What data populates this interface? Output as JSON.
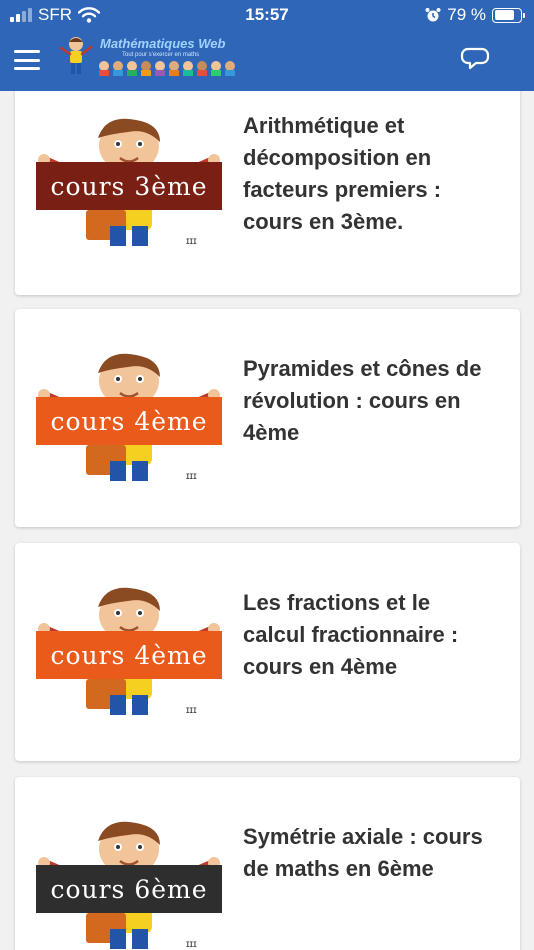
{
  "status_bar": {
    "carrier": "SFR",
    "time": "15:57",
    "battery": "79 %",
    "battery_level": 0.79
  },
  "header": {
    "logo_title": "Mathématiques Web",
    "logo_subtitle": "Tout pour s'exercer en maths",
    "menu_icon": "hamburger-menu-icon",
    "chat_icon": "chat-bubbles-icon",
    "colors": {
      "bar": "#2f66b7"
    }
  },
  "articles": [
    {
      "badge": "cours 3ème",
      "badge_color": "#7a1f14",
      "title": "Arithmétique et décomposition en facteurs premiers : cours en 3ème."
    },
    {
      "badge": "cours 4ème",
      "badge_color": "#ea5a1b",
      "title": "Pyramides et cônes de révolution : cours en 4ème"
    },
    {
      "badge": "cours 4ème",
      "badge_color": "#ea5a1b",
      "title": "Les fractions et le calcul fractionnaire : cours en 4ème"
    },
    {
      "badge": "cours 6ème",
      "badge_color": "#2e2e2e",
      "title": "Symétrie axiale : cours de maths en 6ème"
    }
  ]
}
